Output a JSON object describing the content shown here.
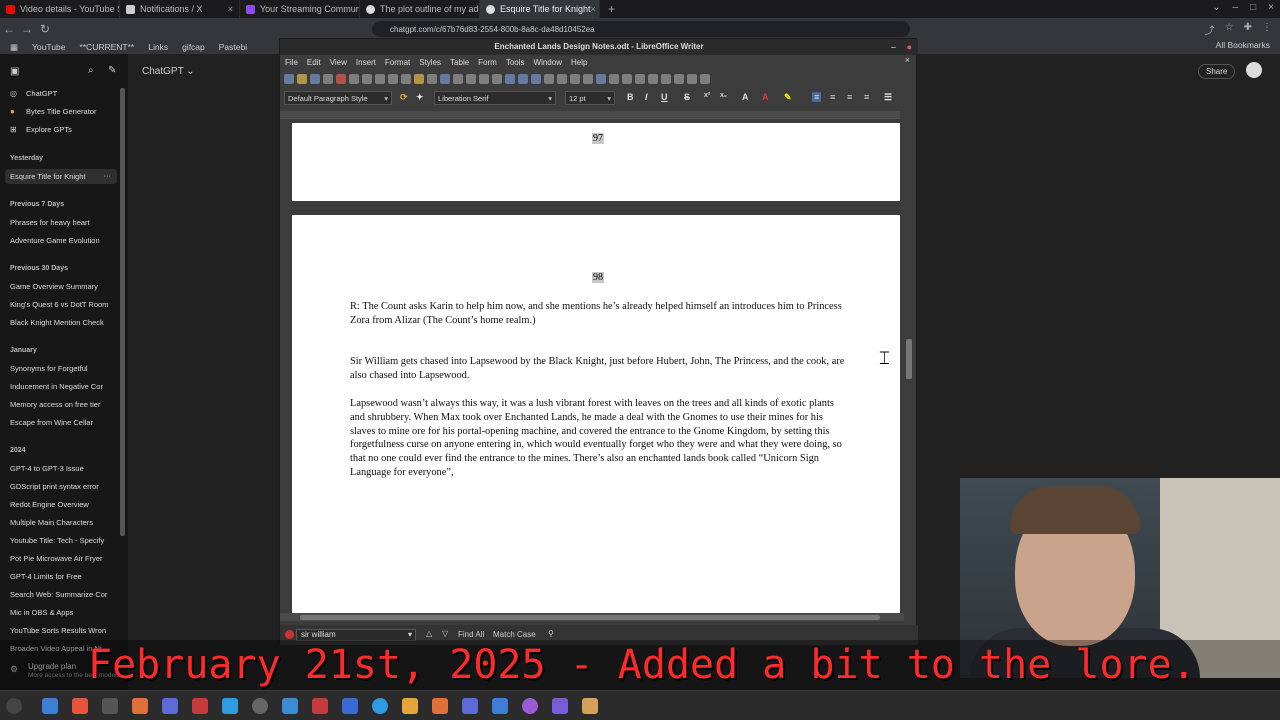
{
  "browser": {
    "tabs": [
      {
        "title": "Video details - YouTube S",
        "color": "#ff0000"
      },
      {
        "title": "Notifications / X",
        "color": "#cccccc"
      },
      {
        "title": "Your Streaming Commun",
        "color": "#9147ff"
      },
      {
        "title": "The plot outline of my ad",
        "color": "#dddddd"
      },
      {
        "title": "Esquire Title for Knight",
        "color": "#dddddd",
        "active": true
      }
    ],
    "url": "chatgpt.com/c/67b76d83-2554-800b-8a8c-da48d10452ea",
    "bookmarks": [
      "YouTube",
      "**CURRENT**",
      "Links",
      "gifcap",
      "Pastebi"
    ],
    "all_bookmarks": "All Bookmarks"
  },
  "chatgpt": {
    "model": "ChatGPT",
    "share": "Share",
    "top_items": [
      "ChatGPT",
      "Bytes Title Generator",
      "Explore GPTs"
    ],
    "sections": [
      {
        "label": "Yesterday",
        "items": [
          "Esquire Title for Knight"
        ]
      },
      {
        "label": "Previous 7 Days",
        "items": [
          "Phrases for heavy heart",
          "Adventure Game Evolution"
        ]
      },
      {
        "label": "Previous 30 Days",
        "items": [
          "Game Overview Summary",
          "King's Quest 6 vs DotT Room",
          "Black Knight Mention Check"
        ]
      },
      {
        "label": "January",
        "items": [
          "Synonyms for Forgetful",
          "Inducement in Negative Cor",
          "Memory access on free tier",
          "Escape from Wine Cellar"
        ]
      },
      {
        "label": "2024",
        "items": [
          "GPT-4 to GPT-3 Issue",
          "GDScript print syntax error",
          "Redot Engine Overview",
          "Multiple Main Characters",
          "Youtube Title: Tech - Specify",
          "Pot Pie Microwave Air Fryer",
          "GPT-4 Limits for Free",
          "Search Web: Summarize Cor",
          "Mic in OBS & Apps",
          "YouTube Sorts Results Wron",
          "Broaden Video Appeal in Ni"
        ]
      }
    ],
    "upgrade": "Upgrade plan",
    "upgrade_sub": "More access to the best models"
  },
  "writer": {
    "title": "Enchanted Lands Design Notes.odt - LibreOffice Writer",
    "menu": [
      "File",
      "Edit",
      "View",
      "Insert",
      "Format",
      "Styles",
      "Table",
      "Form",
      "Tools",
      "Window",
      "Help"
    ],
    "para_style": "Default Paragraph Style",
    "font": "Liberation Serif",
    "size": "12 pt",
    "page_prev": "97",
    "page_cur": "98",
    "paragraphs": [
      "R:  The Count asks Karin to help him now, and she mentions he’s already helped himself an introduces him to Princess Zora from Alizar (The Count’s home realm.)",
      "Sir William gets chased into Lapsewood by the Black Knight, just before Hubert, John, The Princess, and the cook, are also chased into Lapsewood.",
      "Lapsewood wasn’t always this way, it was a lush vibrant forest with leaves on the trees and all kinds of exotic plants and shrubbery.  When Max took over Enchanted Lands, he made a deal with the Gnomes to use their mines for his slaves to mine ore for his portal-opening machine, and covered the entrance to the Gnome Kingdom, by setting this forgetfulness curse on anyone entering in, which would eventually forget who they were and what they were doing, so that no one could ever find the entrance to the mines.  There’s also an enchanted lands book called “Unicorn Sign Language for everyone”, "
    ],
    "find_text": "sir william",
    "find_all": "Find All",
    "match_case": "Match Case"
  },
  "caption": "February 21st, 2025 - Added a bit to the lore."
}
